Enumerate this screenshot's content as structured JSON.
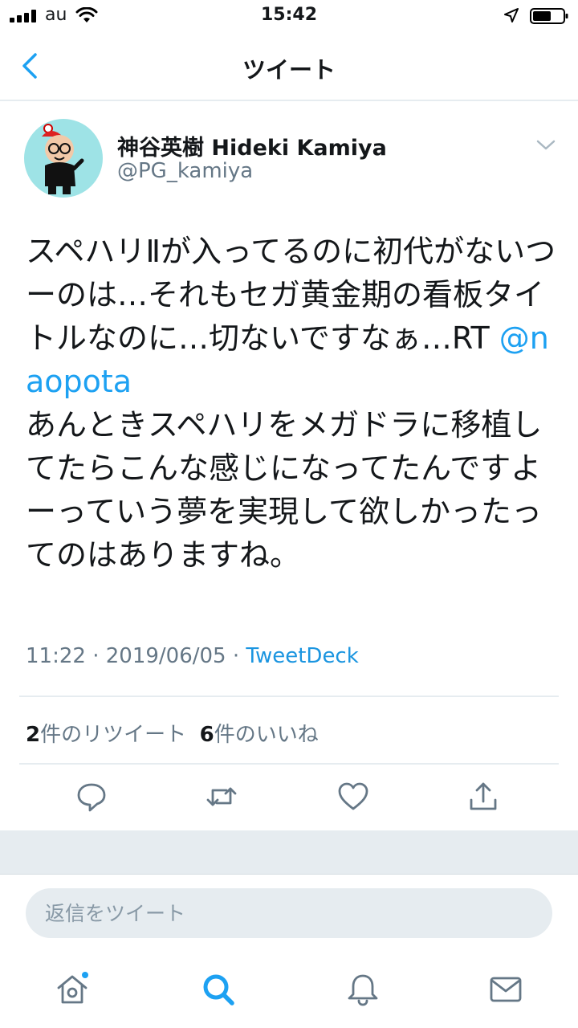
{
  "status_bar": {
    "carrier": "au",
    "time": "15:42"
  },
  "nav": {
    "title": "ツイート"
  },
  "tweet": {
    "display_name": "神谷英樹 Hideki Kamiya",
    "handle": "@PG_kamiya",
    "text_before_mention": "スペハリⅡが入ってるのに初代がないつーのは…それもセガ黄金期の看板タイトルなのに…切ないですなぁ…RT ",
    "mention": "@naopota",
    "text_after_mention": "\nあんときスペハリをメガドラに移植してたらこんな感じになってたんですよーっていう夢を実現して欲しかったってのはありますね。",
    "time": "11:22",
    "date": "2019/06/05",
    "separator": " · ",
    "source": "TweetDeck",
    "retweet_count": "2",
    "retweet_label": "件のリツイート",
    "like_count": "6",
    "like_label": "件のいいね"
  },
  "reply": {
    "placeholder": "返信をツイート"
  },
  "icons": {
    "back": "chevron-left-icon",
    "menu": "chevron-down-icon",
    "reply": "speech-bubble-icon",
    "retweet": "retweet-icon",
    "like": "heart-icon",
    "share": "share-icon",
    "home": "home-icon",
    "search": "search-icon",
    "notifications": "bell-icon",
    "messages": "envelope-icon"
  },
  "colors": {
    "accent": "#1da1f2",
    "secondary_text": "#657786",
    "divider": "#e6ecf0",
    "avatar_bg": "#9ee3e6"
  }
}
